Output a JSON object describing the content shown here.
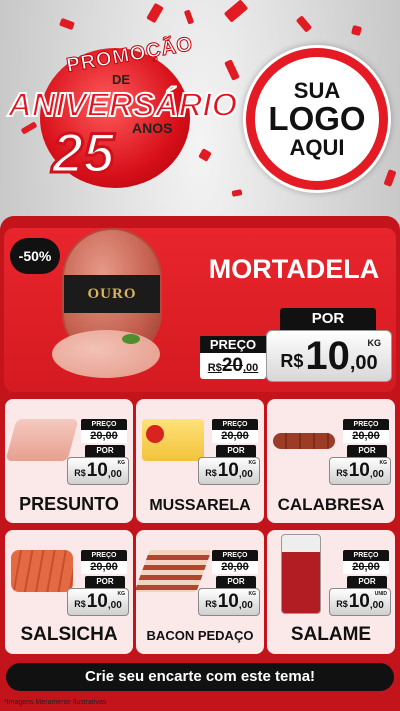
{
  "header": {
    "promo_line1": "PROMOÇÃO",
    "promo_line2": "DE",
    "promo_line3": "ANIVERSÁRIO",
    "promo_number": "25",
    "promo_suffix": "ANOS",
    "logo_line1": "SUA",
    "logo_line2": "LOGO",
    "logo_line3": "AQUI"
  },
  "hero": {
    "discount": "-50%",
    "brand": "OURO",
    "name": "MORTADELA",
    "preco_label": "PREÇO",
    "old_price": "20",
    "old_price_cents": ",00",
    "old_price_prefix": "R$",
    "por_label": "POR",
    "currency": "R$",
    "new_price": "10",
    "new_price_cents": ",00",
    "unit": "KG"
  },
  "products": [
    {
      "name": "PRESUNTO",
      "preco_label": "PREÇO",
      "old_price": "20",
      "old_cents": ",00",
      "por_label": "POR",
      "currency": "R$",
      "price": "10",
      "cents": ",00",
      "unit": "KG"
    },
    {
      "name": "MUSSARELA",
      "preco_label": "PREÇO",
      "old_price": "20",
      "old_cents": ",00",
      "por_label": "POR",
      "currency": "R$",
      "price": "10",
      "cents": ",00",
      "unit": "KG"
    },
    {
      "name": "CALABRESA",
      "preco_label": "PREÇO",
      "old_price": "20",
      "old_cents": ",00",
      "por_label": "POR",
      "currency": "R$",
      "price": "10",
      "cents": ",00",
      "unit": "KG"
    },
    {
      "name": "SALSICHA",
      "preco_label": "PREÇO",
      "old_price": "20",
      "old_cents": ",00",
      "por_label": "POR",
      "currency": "R$",
      "price": "10",
      "cents": ",00",
      "unit": "KG"
    },
    {
      "name": "BACON PEDAÇO",
      "preco_label": "PREÇO",
      "old_price": "20",
      "old_cents": ",00",
      "por_label": "POR",
      "currency": "R$",
      "price": "10",
      "cents": ",00",
      "unit": "KG"
    },
    {
      "name": "SALAME",
      "preco_label": "PREÇO",
      "old_price": "20",
      "old_cents": ",00",
      "por_label": "POR",
      "currency": "R$",
      "price": "10",
      "cents": ",00",
      "unit": "UNID"
    }
  ],
  "footer": {
    "cta": "Crie seu encarte com este tema!",
    "disclaimer": "*Imagens Meramente Ilustrativas"
  },
  "colors": {
    "primary_red": "#c4141b",
    "card_bg": "#fbe9ea",
    "dark": "#111111"
  }
}
